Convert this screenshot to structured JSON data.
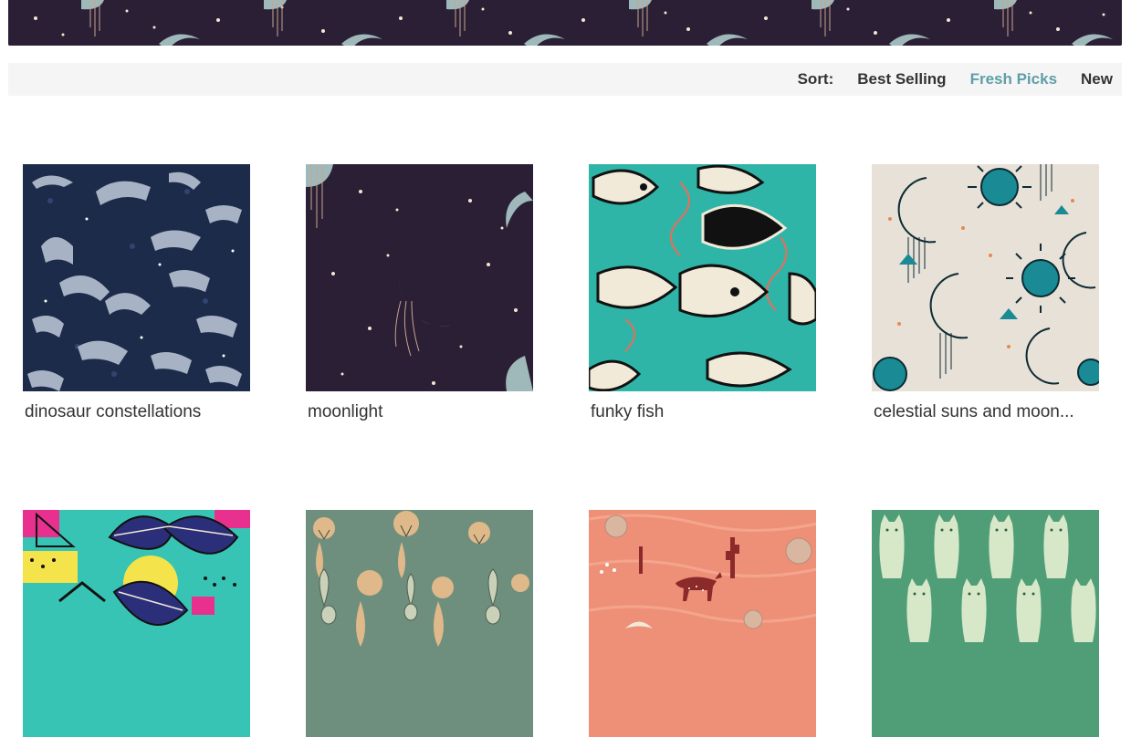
{
  "sort": {
    "label": "Sort:",
    "options": [
      "Best Selling",
      "Fresh Picks",
      "New"
    ],
    "active": "Fresh Picks",
    "active_color": "#5f9ea8"
  },
  "products": [
    {
      "title": "dinosaur constellations",
      "pattern": "dinosaur-pattern-icon",
      "bg": "#1d2b4a"
    },
    {
      "title": "moonlight",
      "pattern": "moon-pattern-icon",
      "bg": "#2a1f35"
    },
    {
      "title": "funky fish",
      "pattern": "fish-pattern-icon",
      "bg": "#2fb5a8"
    },
    {
      "title": "celestial suns and moon...",
      "pattern": "sun-moon-pattern-icon",
      "bg": "#e8e1d8"
    },
    {
      "title": "",
      "pattern": "tropical-leaf-pattern-icon",
      "bg": "#37c4b4"
    },
    {
      "title": "",
      "pattern": "mandrake-pattern-icon",
      "bg": "#6f8f7e"
    },
    {
      "title": "",
      "pattern": "desert-coyote-pattern-icon",
      "bg": "#ee9078"
    },
    {
      "title": "",
      "pattern": "cat-pattern-icon",
      "bg": "#4f9e78"
    }
  ]
}
